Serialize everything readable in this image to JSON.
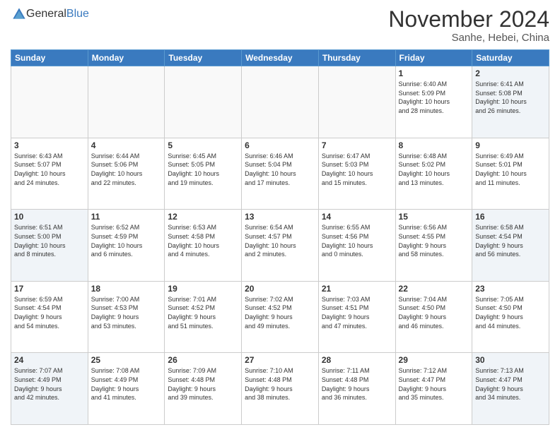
{
  "header": {
    "logo_general": "General",
    "logo_blue": "Blue",
    "month_title": "November 2024",
    "subtitle": "Sanhe, Hebei, China"
  },
  "weekdays": [
    "Sunday",
    "Monday",
    "Tuesday",
    "Wednesday",
    "Thursday",
    "Friday",
    "Saturday"
  ],
  "weeks": [
    [
      {
        "day": "",
        "info": ""
      },
      {
        "day": "",
        "info": ""
      },
      {
        "day": "",
        "info": ""
      },
      {
        "day": "",
        "info": ""
      },
      {
        "day": "",
        "info": ""
      },
      {
        "day": "1",
        "info": "Sunrise: 6:40 AM\nSunset: 5:09 PM\nDaylight: 10 hours\nand 28 minutes."
      },
      {
        "day": "2",
        "info": "Sunrise: 6:41 AM\nSunset: 5:08 PM\nDaylight: 10 hours\nand 26 minutes."
      }
    ],
    [
      {
        "day": "3",
        "info": "Sunrise: 6:43 AM\nSunset: 5:07 PM\nDaylight: 10 hours\nand 24 minutes."
      },
      {
        "day": "4",
        "info": "Sunrise: 6:44 AM\nSunset: 5:06 PM\nDaylight: 10 hours\nand 22 minutes."
      },
      {
        "day": "5",
        "info": "Sunrise: 6:45 AM\nSunset: 5:05 PM\nDaylight: 10 hours\nand 19 minutes."
      },
      {
        "day": "6",
        "info": "Sunrise: 6:46 AM\nSunset: 5:04 PM\nDaylight: 10 hours\nand 17 minutes."
      },
      {
        "day": "7",
        "info": "Sunrise: 6:47 AM\nSunset: 5:03 PM\nDaylight: 10 hours\nand 15 minutes."
      },
      {
        "day": "8",
        "info": "Sunrise: 6:48 AM\nSunset: 5:02 PM\nDaylight: 10 hours\nand 13 minutes."
      },
      {
        "day": "9",
        "info": "Sunrise: 6:49 AM\nSunset: 5:01 PM\nDaylight: 10 hours\nand 11 minutes."
      }
    ],
    [
      {
        "day": "10",
        "info": "Sunrise: 6:51 AM\nSunset: 5:00 PM\nDaylight: 10 hours\nand 8 minutes."
      },
      {
        "day": "11",
        "info": "Sunrise: 6:52 AM\nSunset: 4:59 PM\nDaylight: 10 hours\nand 6 minutes."
      },
      {
        "day": "12",
        "info": "Sunrise: 6:53 AM\nSunset: 4:58 PM\nDaylight: 10 hours\nand 4 minutes."
      },
      {
        "day": "13",
        "info": "Sunrise: 6:54 AM\nSunset: 4:57 PM\nDaylight: 10 hours\nand 2 minutes."
      },
      {
        "day": "14",
        "info": "Sunrise: 6:55 AM\nSunset: 4:56 PM\nDaylight: 10 hours\nand 0 minutes."
      },
      {
        "day": "15",
        "info": "Sunrise: 6:56 AM\nSunset: 4:55 PM\nDaylight: 9 hours\nand 58 minutes."
      },
      {
        "day": "16",
        "info": "Sunrise: 6:58 AM\nSunset: 4:54 PM\nDaylight: 9 hours\nand 56 minutes."
      }
    ],
    [
      {
        "day": "17",
        "info": "Sunrise: 6:59 AM\nSunset: 4:54 PM\nDaylight: 9 hours\nand 54 minutes."
      },
      {
        "day": "18",
        "info": "Sunrise: 7:00 AM\nSunset: 4:53 PM\nDaylight: 9 hours\nand 53 minutes."
      },
      {
        "day": "19",
        "info": "Sunrise: 7:01 AM\nSunset: 4:52 PM\nDaylight: 9 hours\nand 51 minutes."
      },
      {
        "day": "20",
        "info": "Sunrise: 7:02 AM\nSunset: 4:52 PM\nDaylight: 9 hours\nand 49 minutes."
      },
      {
        "day": "21",
        "info": "Sunrise: 7:03 AM\nSunset: 4:51 PM\nDaylight: 9 hours\nand 47 minutes."
      },
      {
        "day": "22",
        "info": "Sunrise: 7:04 AM\nSunset: 4:50 PM\nDaylight: 9 hours\nand 46 minutes."
      },
      {
        "day": "23",
        "info": "Sunrise: 7:05 AM\nSunset: 4:50 PM\nDaylight: 9 hours\nand 44 minutes."
      }
    ],
    [
      {
        "day": "24",
        "info": "Sunrise: 7:07 AM\nSunset: 4:49 PM\nDaylight: 9 hours\nand 42 minutes."
      },
      {
        "day": "25",
        "info": "Sunrise: 7:08 AM\nSunset: 4:49 PM\nDaylight: 9 hours\nand 41 minutes."
      },
      {
        "day": "26",
        "info": "Sunrise: 7:09 AM\nSunset: 4:48 PM\nDaylight: 9 hours\nand 39 minutes."
      },
      {
        "day": "27",
        "info": "Sunrise: 7:10 AM\nSunset: 4:48 PM\nDaylight: 9 hours\nand 38 minutes."
      },
      {
        "day": "28",
        "info": "Sunrise: 7:11 AM\nSunset: 4:48 PM\nDaylight: 9 hours\nand 36 minutes."
      },
      {
        "day": "29",
        "info": "Sunrise: 7:12 AM\nSunset: 4:47 PM\nDaylight: 9 hours\nand 35 minutes."
      },
      {
        "day": "30",
        "info": "Sunrise: 7:13 AM\nSunset: 4:47 PM\nDaylight: 9 hours\nand 34 minutes."
      }
    ]
  ]
}
